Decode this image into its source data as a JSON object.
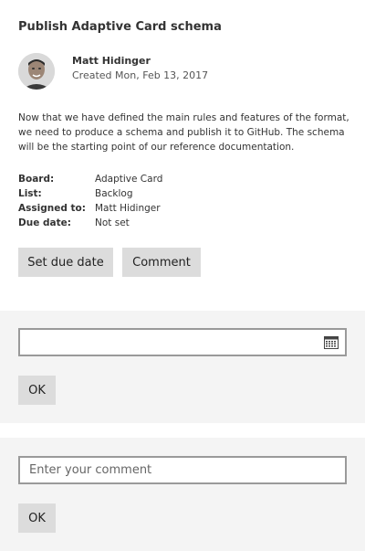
{
  "card": {
    "title": "Publish Adaptive Card schema",
    "author": {
      "name": "Matt Hidinger",
      "created": "Created Mon, Feb 13, 2017"
    },
    "description": "Now that we have defined the main rules and features of the format, we need to produce a schema and publish it to GitHub. The schema will be the starting point of our reference documentation.",
    "facts": [
      {
        "key": "Board:",
        "value": "Adaptive Card"
      },
      {
        "key": "List:",
        "value": "Backlog"
      },
      {
        "key": "Assigned to:",
        "value": "Matt Hidinger"
      },
      {
        "key": "Due date:",
        "value": "Not set"
      }
    ],
    "actions": {
      "set_due_date": "Set due date",
      "comment": "Comment"
    }
  },
  "due_date_panel": {
    "date_value": "",
    "ok_label": "OK"
  },
  "comment_panel": {
    "placeholder": "Enter your comment",
    "ok_label": "OK"
  }
}
